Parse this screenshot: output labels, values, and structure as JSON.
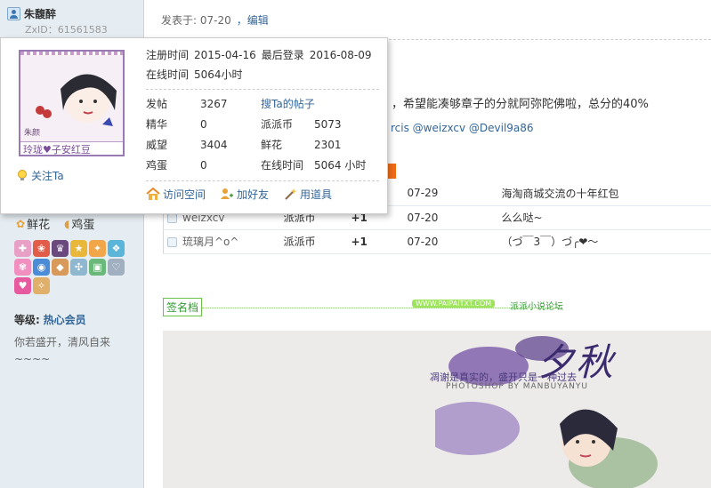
{
  "user": {
    "name": "朱馥醉",
    "zxid": "ZxID：61561583",
    "gifts": [
      {
        "label": "鲜花"
      },
      {
        "label": "鸡蛋"
      }
    ],
    "level_label": "等级:",
    "level_value": "热心会员",
    "signature_text": "你若盛开，清风自来~~~~"
  },
  "popup": {
    "avatar_caption": "玲珑♥子安红豆",
    "avatar_name": "朱颜",
    "follow_label": "关注Ta",
    "register_label": "注册时间",
    "register_value": "2015-04-16",
    "lastlogin_label": "最后登录",
    "lastlogin_value": "2016-08-09",
    "online_label": "在线时间",
    "online_value": "5064小时",
    "stats": [
      {
        "l1": "发帖",
        "v1": "3267",
        "l2": "搜Ta的帖子",
        "v2": ""
      },
      {
        "l1": "精华",
        "v1": "0",
        "l2": "派派币",
        "v2": "5073"
      },
      {
        "l1": "威望",
        "v1": "3404",
        "l2": "鲜花",
        "v2": "2301"
      },
      {
        "l1": "鸡蛋",
        "v1": "0",
        "l2": "在线时间",
        "v2": "5064 小时"
      }
    ],
    "actions": {
      "visit": "访问空间",
      "add_friend": "加好友",
      "use_item": "用道具"
    }
  },
  "post": {
    "meta_prefix": "发表于: 07-20",
    "edit_label": "，编辑",
    "text": "，希望能凑够章子的分就阿弥陀佛啦，总分的40%",
    "mentions": "rcis @weizxcv @Devil9a86"
  },
  "rates": [
    {
      "user": "",
      "type": "",
      "amount": "",
      "date": "07-29",
      "reason": "海淘商城交流の十年红包"
    },
    {
      "user": "weizxcv",
      "type": "派派币",
      "amount": "+1",
      "date": "07-20",
      "reason": "么么哒~"
    },
    {
      "user": "琉璃月^o^",
      "type": "派派币",
      "amount": "+1",
      "date": "07-20",
      "reason": "（づ￣3￣）づ╭❤～"
    }
  ],
  "signature": {
    "badge": "签名档",
    "site": "WWW.PAIPAITXT.COM",
    "forum": "派派小说论坛",
    "banner_title": "夕秋",
    "banner_quote": "凋谢是真实的，盛开只是一种过去",
    "banner_credit": "PHOTOSHOP BY MANBUYANYU"
  },
  "colors": {
    "link": "#336699",
    "accent_orange": "#f26c17",
    "sidebar_bg": "#e5edf2",
    "sig_green": "#339933"
  }
}
